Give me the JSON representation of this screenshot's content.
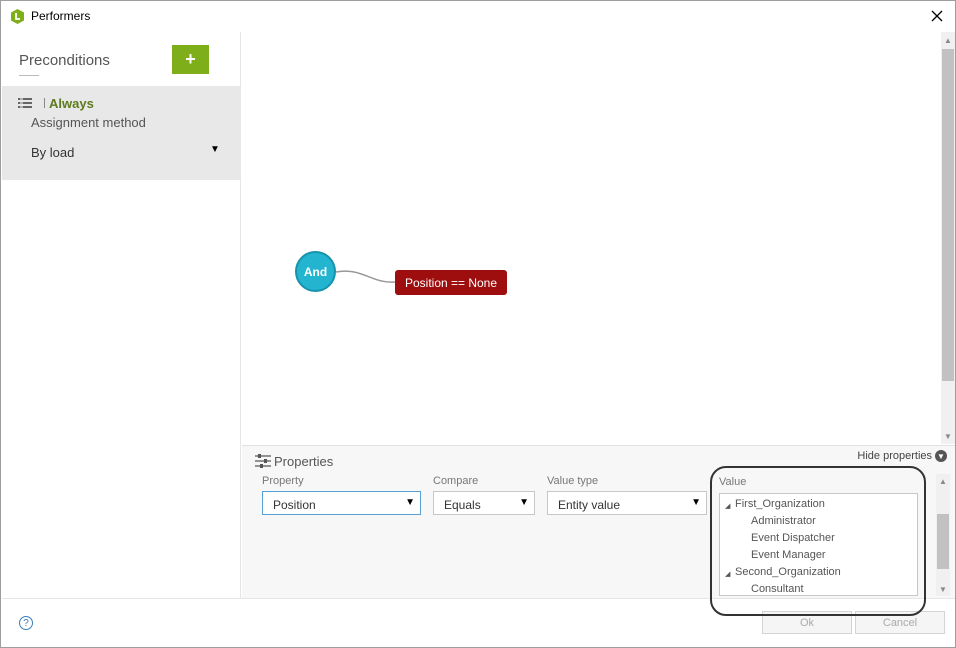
{
  "window": {
    "title": "Performers",
    "app_icon": "leaf-logo-icon",
    "close_icon": "close-icon"
  },
  "colors": {
    "accent_green": "#7fae1b",
    "node_and": "#23b4cf",
    "node_condition": "#9e0e0e",
    "item_name": "#5d7a1e"
  },
  "preconditions": {
    "title": "Preconditions",
    "add_label": "+",
    "items": [
      {
        "name": "Always",
        "assignment_label": "Assignment method",
        "assignment_value": "By load"
      }
    ]
  },
  "canvas": {
    "nodes": [
      {
        "label": "And",
        "kind": "operator"
      },
      {
        "label": "Position == None",
        "kind": "condition"
      }
    ]
  },
  "properties": {
    "title": "Properties",
    "hide_label": "Hide properties",
    "fields": {
      "property": {
        "label": "Property",
        "value": "Position"
      },
      "compare": {
        "label": "Compare",
        "value": "Equals"
      },
      "value_type": {
        "label": "Value type",
        "value": "Entity value"
      },
      "value": {
        "label": "Value"
      }
    },
    "value_tree": [
      {
        "label": "First_Organization",
        "expanded": true,
        "children": [
          "Administrator",
          "Event Dispatcher",
          "Event Manager"
        ]
      },
      {
        "label": "Second_Organization",
        "expanded": true,
        "children": [
          "Consultant"
        ]
      }
    ]
  },
  "footer": {
    "help_label": "?",
    "ok_label": "Ok",
    "cancel_label": "Cancel"
  }
}
